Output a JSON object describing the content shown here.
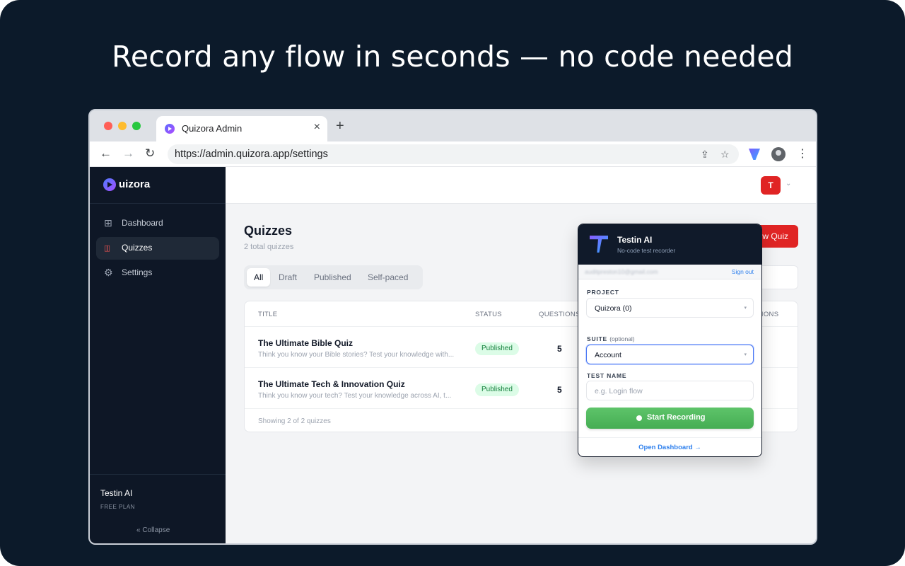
{
  "headline": "Record any flow in seconds — no code needed",
  "browser": {
    "tab_title": "Quizora Admin",
    "tab_close": "×",
    "new_tab": "+",
    "back": "←",
    "forward": "→",
    "reload": "↻",
    "url": "https://admin.quizora.app/settings",
    "share_icon": "⇪",
    "star_icon": "☆",
    "menu_icon": "⋮"
  },
  "sidebar": {
    "logo_text": "uizora",
    "items": [
      {
        "label": "Dashboard",
        "icon": "⊞"
      },
      {
        "label": "Quizzes",
        "icon": "▯▯"
      },
      {
        "label": "Settings",
        "icon": "⚙"
      }
    ],
    "user_name": "Testin AI",
    "user_plan": "FREE PLAN",
    "collapse_label": "«   Collapse"
  },
  "topbar": {
    "avatar_letter": "T",
    "caret": "⌄"
  },
  "page": {
    "title": "Quizzes",
    "subtitle": "2 total quizzes",
    "new_button": "+ New Quiz",
    "filters": [
      "All",
      "Draft",
      "Published",
      "Self-paced"
    ]
  },
  "table": {
    "headers": {
      "title": "TITLE",
      "status": "STATUS",
      "questions": "QUESTIONS",
      "actions": "ACTIONS"
    },
    "rows": [
      {
        "title": "The Ultimate Bible Quiz",
        "description": "Think you know your Bible stories? Test your knowledge with...",
        "status": "Published",
        "questions": "5"
      },
      {
        "title": "The Ultimate Tech & Innovation Quiz",
        "description": "Think you know your tech? Test your knowledge across AI, t...",
        "status": "Published",
        "questions": "5"
      }
    ],
    "footer": "Showing 2 of 2 quizzes"
  },
  "popup": {
    "title": "Testin AI",
    "subtitle": "No-code test recorder",
    "email": "auditpreston10@gmail.com",
    "sign_out": "Sign out",
    "project_label": "PROJECT",
    "project_value": "Quizora (0)",
    "suite_label": "SUITE",
    "suite_optional": "(optional)",
    "suite_value": "Account",
    "test_name_label": "TEST NAME",
    "test_name_placeholder": "e.g. Login flow",
    "start_recording": "Start Recording",
    "open_dashboard": "Open Dashboard →",
    "select_caret": "▾"
  },
  "colors": {
    "backdrop": "#0c1a2a",
    "sidebar": "#0e1726",
    "accent_red": "#e02424",
    "record_green": "#4fb85c",
    "link_blue": "#2f80ed"
  }
}
